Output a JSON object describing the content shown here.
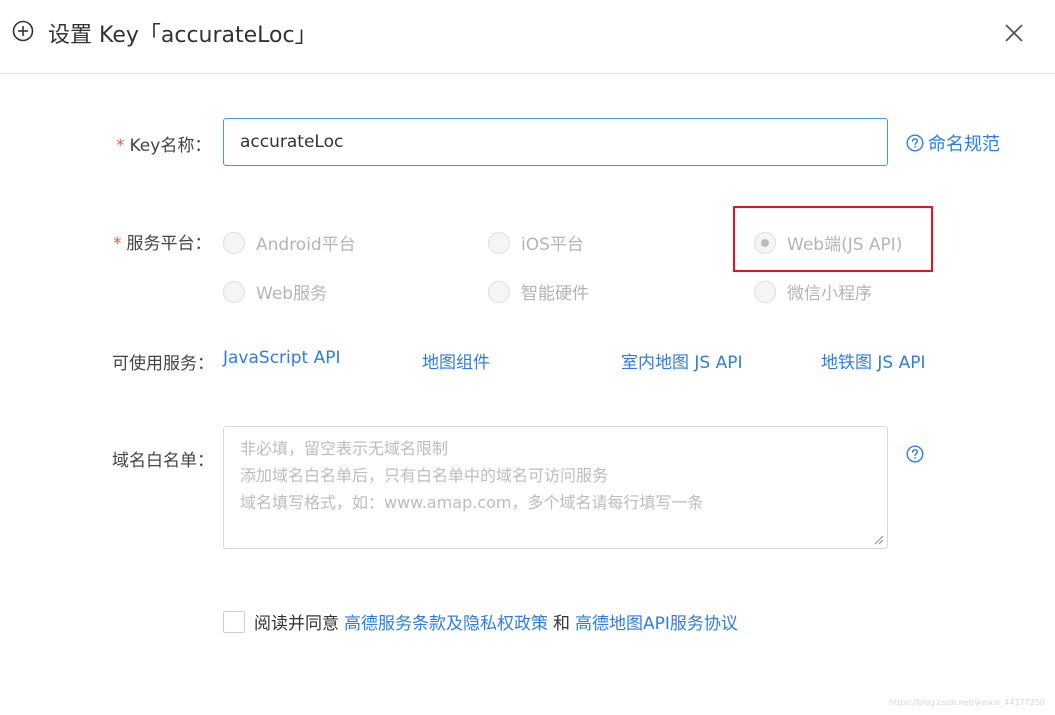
{
  "dialog": {
    "title": "设置 Key「accurateLoc」",
    "icons": {
      "header_icon": "plus-circle-icon",
      "close": "close-icon"
    }
  },
  "form": {
    "key_name": {
      "required_mark": "*",
      "label": "Key名称：",
      "value": "accurateLoc",
      "help_link": "命名规范"
    },
    "platform": {
      "required_mark": "*",
      "label": "服务平台：",
      "options": [
        {
          "label": "Android平台",
          "selected": false,
          "disabled": true
        },
        {
          "label": "iOS平台",
          "selected": false,
          "disabled": true
        },
        {
          "label": "Web端(JS API)",
          "selected": true,
          "disabled": true
        },
        {
          "label": "Web服务",
          "selected": false,
          "disabled": true
        },
        {
          "label": "智能硬件",
          "selected": false,
          "disabled": true
        },
        {
          "label": "微信小程序",
          "selected": false,
          "disabled": true
        }
      ],
      "highlight_color": "#e5141f"
    },
    "services": {
      "label": "可使用服务：",
      "items": [
        "JavaScript API",
        "地图组件",
        "室内地图 JS API",
        "地铁图 JS API"
      ]
    },
    "domain_whitelist": {
      "label": "域名白名单：",
      "placeholder": "非必填，留空表示无域名限制\n添加域名白名单后，只有白名单中的域名可访问服务\n域名填写格式，如：www.amap.com，多个域名请每行填写一条",
      "value": ""
    },
    "agreement": {
      "checked": false,
      "prefix": "阅读并同意",
      "link1": "高德服务条款及隐私权政策",
      "and": "和",
      "link2": "高德地图API服务协议"
    }
  },
  "watermark": "https://blog.csdn.net/weixin_44177250",
  "colors": {
    "link": "#2f7de1",
    "required": "#ee5a3c",
    "input_focus_border": "#4c95ef"
  }
}
